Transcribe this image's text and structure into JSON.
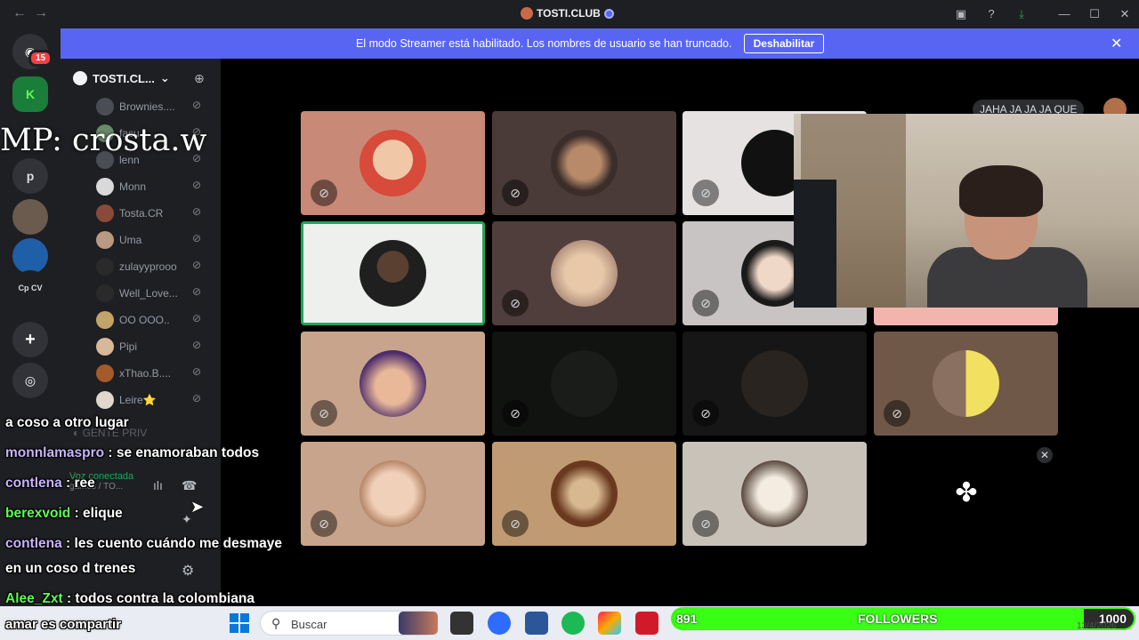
{
  "window": {
    "title": "TOSTI.CLUB",
    "back": "←",
    "forward": "→"
  },
  "rail": {
    "badge": "15",
    "servers": [
      "p",
      "Cp CV"
    ]
  },
  "banner": {
    "message": "El modo Streamer está habilitado. Los nombres de usuario se han truncado.",
    "button": "Deshabilitar"
  },
  "sidebar": {
    "server_name": "TOSTI.CL...",
    "members": [
      "Brownies....",
      "facu",
      "lenn",
      "Monn",
      "Tosta.CR",
      "Uma",
      "zulayyprooo",
      "Well_Love...",
      "ΟΟ ΟΟΟ..",
      "Pipi",
      "xThao.B....",
      "Leire⭐"
    ],
    "category": "GENTE PRIV",
    "voice_connected": "Voz conectada",
    "voice_channel": "games / TO..."
  },
  "overlay_tag": "MP: crosta.w",
  "chat": [
    {
      "user": "",
      "text": "a coso a otro lugar"
    },
    {
      "user": "monnlamaspro",
      "text": ": se enamoraban todos"
    },
    {
      "user": "contlena",
      "text": ": ree"
    },
    {
      "user": "berexvoid",
      "text": ": elique"
    },
    {
      "user": "contlena",
      "text": ": les cuento cuándo me desmaye"
    },
    {
      "user": "",
      "text": "en un coso d trenes"
    },
    {
      "user": "Alee_Zxt",
      "text": ": todos contra la colombiana"
    },
    {
      "user": "",
      "text": "amar es compartir"
    }
  ],
  "reply_pill": "JAHA JA JA JA QUE",
  "taskbar": {
    "search_placeholder": "Buscar"
  },
  "followers": {
    "current": "891",
    "label": "FOLLOWERS",
    "goal": "1000",
    "progress": 0.891
  },
  "date": "13/4/2026",
  "colors": {
    "brand": "#5865f2",
    "accent_green": "#39ff14",
    "speaking": "#23a55a"
  },
  "icons": [
    "discord-icon",
    "mute-icon",
    "settings-icon",
    "windows-icon",
    "search-icon",
    "close-icon",
    "activities-icon"
  ]
}
